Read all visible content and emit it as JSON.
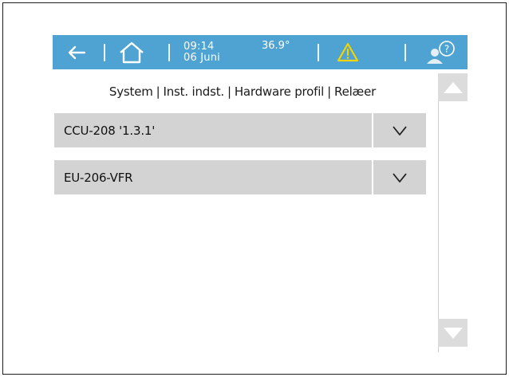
{
  "topbar": {
    "time": "09:14",
    "date": "06 Juni",
    "temperature": "36.9°",
    "icons": [
      "back-arrow-icon",
      "home-icon",
      "warning-icon",
      "user-help-icon"
    ],
    "background_color": "#4ea3d2",
    "warning_color": "#f5d400"
  },
  "breadcrumb": {
    "items": [
      "System",
      "Inst. indst.",
      "Hardware profil",
      "Relæer"
    ]
  },
  "rows": [
    {
      "label": "CCU-208 '1.3.1'"
    },
    {
      "label": "EU-206-VFR"
    }
  ],
  "row_background": "#d3d3d3"
}
